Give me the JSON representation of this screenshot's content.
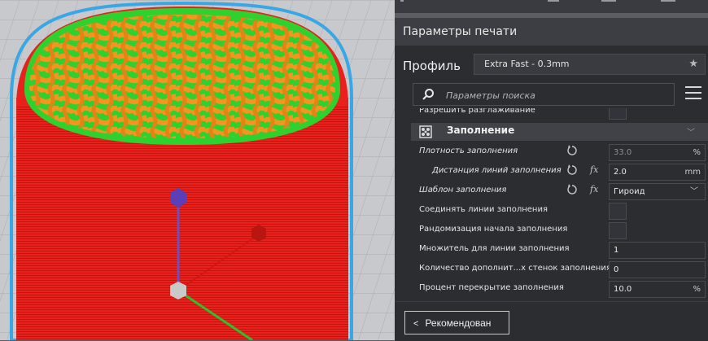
{
  "panel": {
    "title": "Параметры печати",
    "profile_label": "Профиль",
    "profile_value": "Extra Fast - 0.3mm",
    "search_placeholder": "Параметры поиска"
  },
  "settings": {
    "partial_row": "Разрешить разглаживание",
    "category": "Заполнение",
    "rows": [
      {
        "label": "Плотность заполнения",
        "value": "33.0",
        "unit": "%"
      },
      {
        "label": "Дистанция линий заполнения",
        "value": "2.0",
        "unit": "mm"
      },
      {
        "label": "Шаблон заполнения",
        "value": "Гироид"
      },
      {
        "label": "Соединять линии заполнения"
      },
      {
        "label": "Рандомизация начала заполнения"
      },
      {
        "label": "Множитель для линии заполнения",
        "value": "1"
      },
      {
        "label": "Количество дополнит...х стенок заполнения",
        "value": "0"
      },
      {
        "label": "Процент перекрытие заполнения",
        "value": "10.0",
        "unit": "%"
      }
    ],
    "fx_symbol": "fx"
  },
  "footer": {
    "recommended_label": "Рекомендован"
  },
  "icons": {
    "star": "star-icon",
    "search": "search-icon",
    "menu": "menu-icon",
    "reset": "reset-icon",
    "infill": "infill-category-icon",
    "chevron": "chevron-down-icon",
    "back": "chevron-left-icon"
  },
  "colors": {
    "object_red": "#e8211c",
    "infill_orange": "#f5951f",
    "skin_green": "#2fd12f",
    "outline_blue": "#39a7e5",
    "panel_bg": "#2c2d31"
  }
}
